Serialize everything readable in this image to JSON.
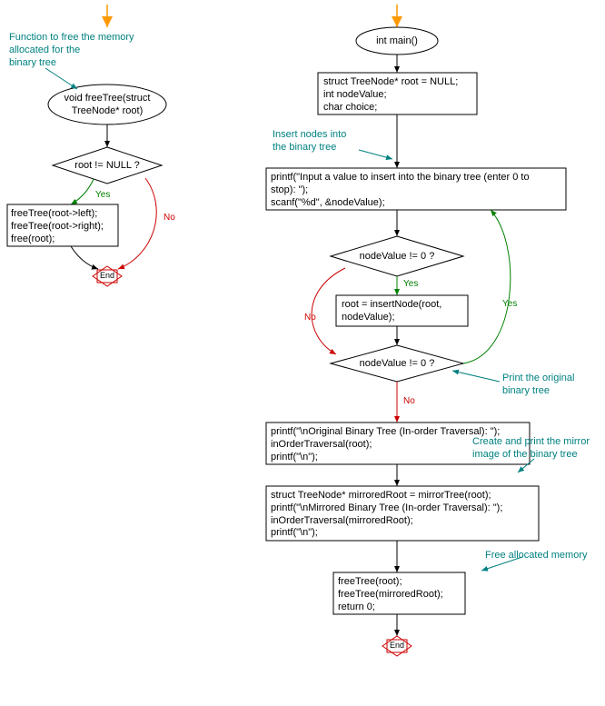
{
  "left": {
    "annotation": "Function to free the memory\nallocated for the\nbinary tree",
    "terminal": "void freeTree(struct\nTreeNode* root)",
    "decision": "root != NULL ?",
    "process": "freeTree(root->left);\nfreeTree(root->right);\nfree(root);",
    "end": "End",
    "yes": "Yes",
    "no": "No"
  },
  "right": {
    "terminal": "int main()",
    "decl": "struct TreeNode* root = NULL;\nint nodeValue;\nchar choice;",
    "ann_insert": "Insert nodes into\nthe binary tree",
    "prompt": "printf(\"Input a value to insert into the binary tree (enter 0 to\nstop): \");\nscanf(\"%d\", &nodeValue);",
    "cond1": "nodeValue != 0 ?",
    "insert": "root = insertNode(root,\nnodeValue);",
    "cond2": "nodeValue != 0 ?",
    "ann_print_orig": "Print the original\nbinary tree",
    "print_orig": "printf(\"\\nOriginal Binary Tree (In-order Traversal): \");\ninOrderTraversal(root);\nprintf(\"\\n\");",
    "ann_mirror": "Create and print the mirror\nimage of the binary tree",
    "mirror": "struct TreeNode* mirroredRoot = mirrorTree(root);\nprintf(\"\\nMirrored Binary Tree (In-order Traversal): \");\ninOrderTraversal(mirroredRoot);\nprintf(\"\\n\");",
    "ann_free": "Free allocated memory",
    "free": "freeTree(root);\nfreeTree(mirroredRoot);\nreturn 0;",
    "end": "End",
    "yes": "Yes",
    "no": "No"
  }
}
